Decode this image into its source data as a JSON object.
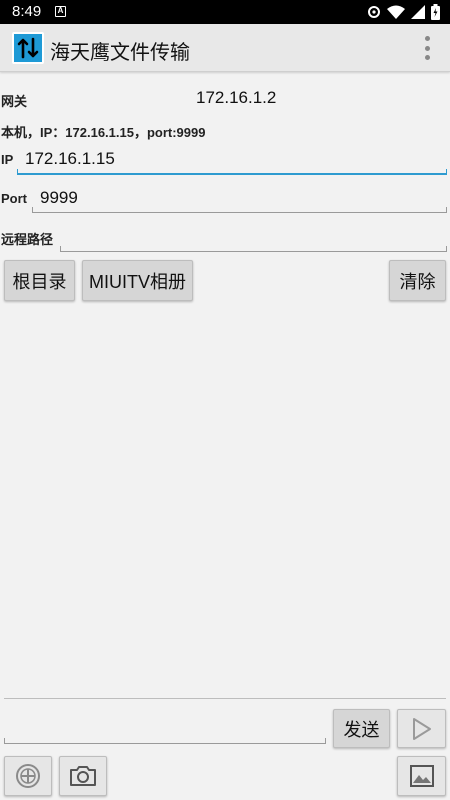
{
  "status": {
    "time": "8:49",
    "notif_letter": "A"
  },
  "app": {
    "title": "海天鹰文件传输"
  },
  "gateway": {
    "label": "网关",
    "value": "172.16.1.2"
  },
  "local": {
    "info": "本机，IP：172.16.1.15，port:9999"
  },
  "ip": {
    "label": "IP",
    "value": "172.16.1.15"
  },
  "port": {
    "label": "Port",
    "value": "9999"
  },
  "remote_path": {
    "label": "远程路径",
    "value": ""
  },
  "buttons": {
    "root": "根目录",
    "album": "MIUITV相册",
    "clear": "清除",
    "send": "发送"
  },
  "message": {
    "value": ""
  },
  "colors": {
    "accent": "#2e9bd0",
    "logo": "#1e9ad6"
  },
  "icons": {
    "send": "play-arrow-icon",
    "add": "add-circle-icon",
    "camera": "camera-icon",
    "gallery": "image-icon",
    "menu": "overflow-menu-icon"
  }
}
